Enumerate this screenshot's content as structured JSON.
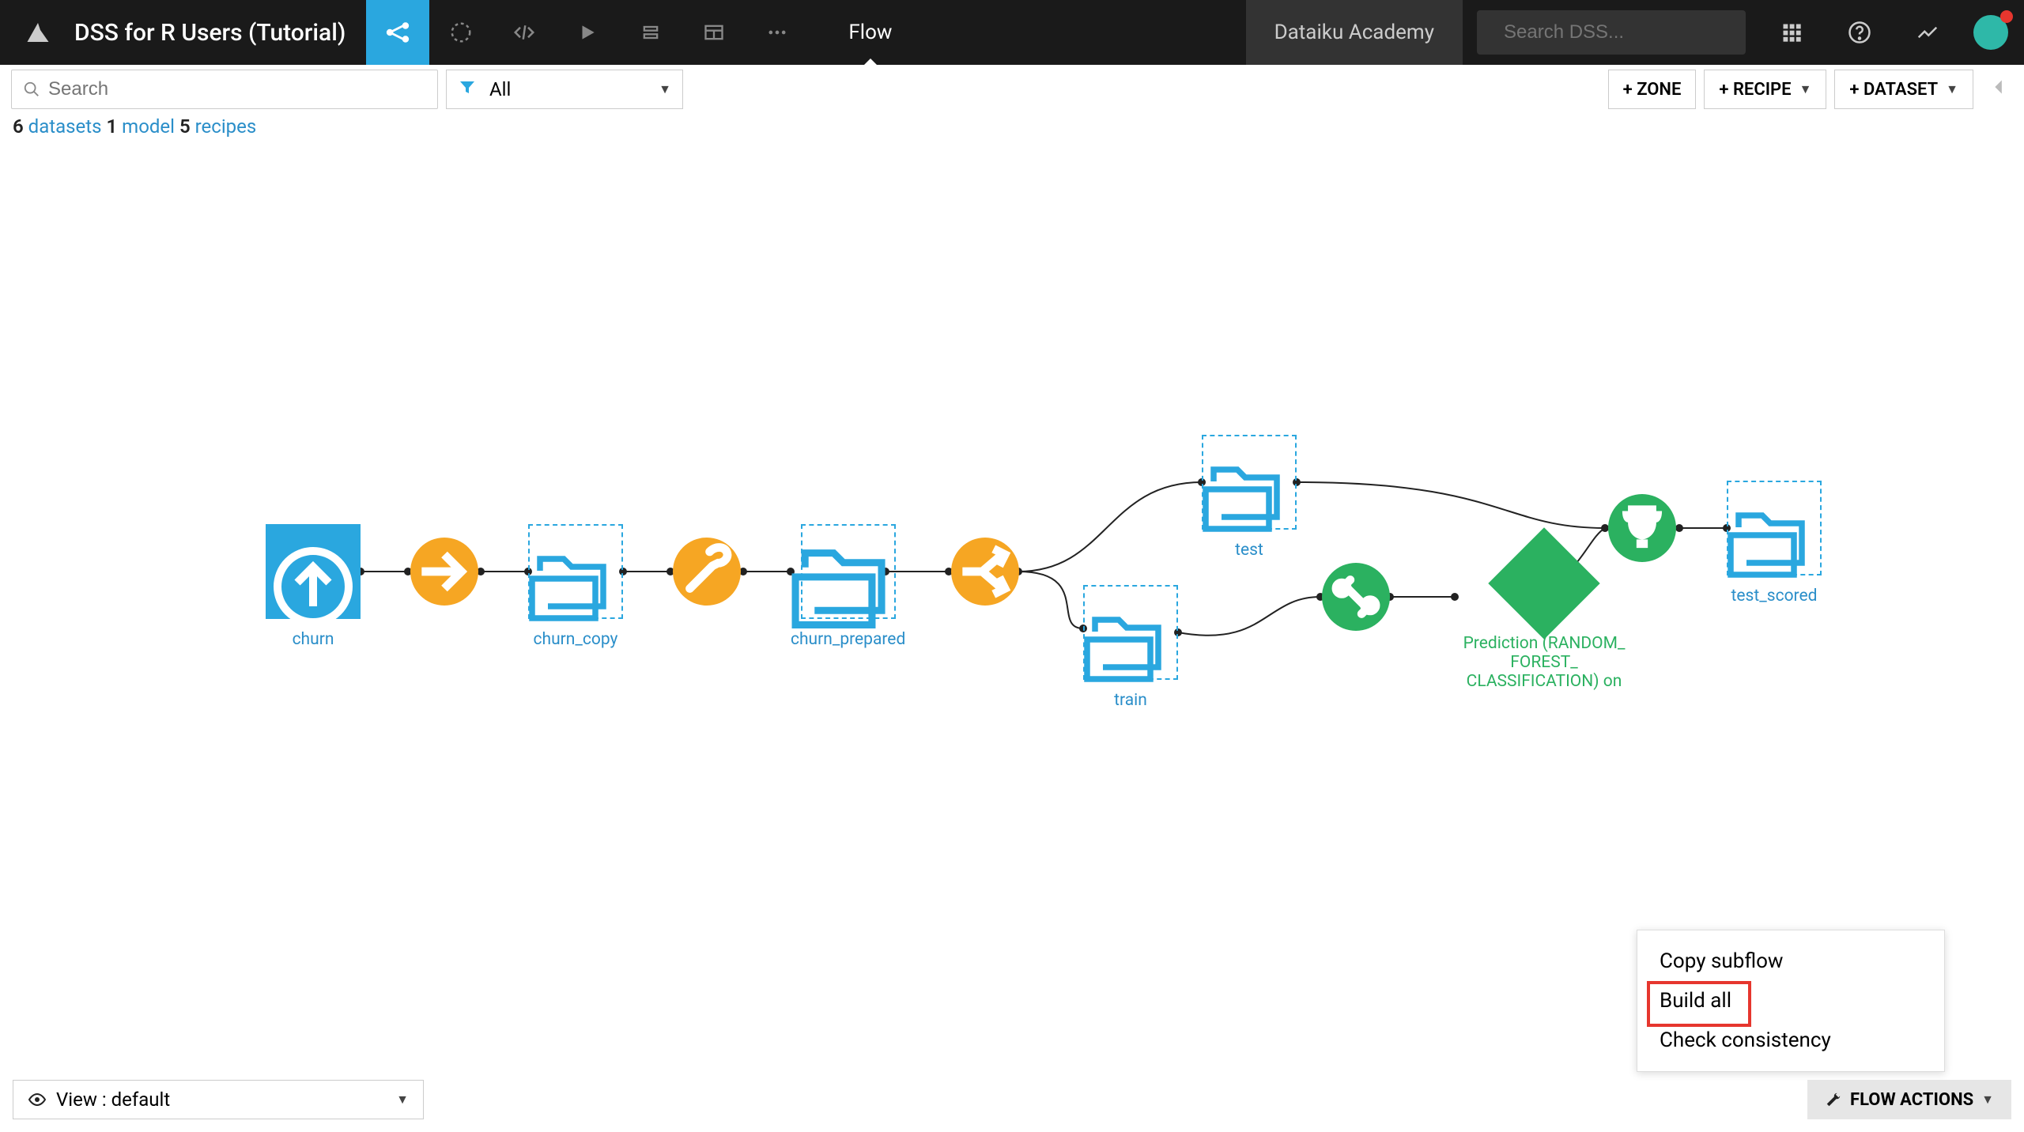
{
  "header": {
    "title": "DSS for R Users (Tutorial)",
    "tab": "Flow",
    "academy": "Dataiku Academy",
    "search_placeholder": "Search DSS..."
  },
  "toolbar": {
    "search_placeholder": "Search",
    "filter_label": "All",
    "add_zone": "+ ZONE",
    "add_recipe": "+ RECIPE",
    "add_dataset": "+ DATASET"
  },
  "counts": {
    "datasets_n": "6",
    "datasets": "datasets",
    "model_n": "1",
    "model": "model",
    "recipes_n": "5",
    "recipes": "recipes"
  },
  "nodes": {
    "churn": "churn",
    "churn_copy": "churn_copy",
    "churn_prepared": "churn_prepared",
    "test": "test",
    "train": "train",
    "prediction": "Prediction (RANDOM_\nFOREST_\nCLASSIFICATION) on",
    "test_scored": "test_scored"
  },
  "footer": {
    "view_label": "View : default",
    "flow_actions": "FLOW ACTIONS"
  },
  "flow_menu": {
    "copy": "Copy subflow",
    "build": "Build all",
    "check": "Check consistency"
  }
}
